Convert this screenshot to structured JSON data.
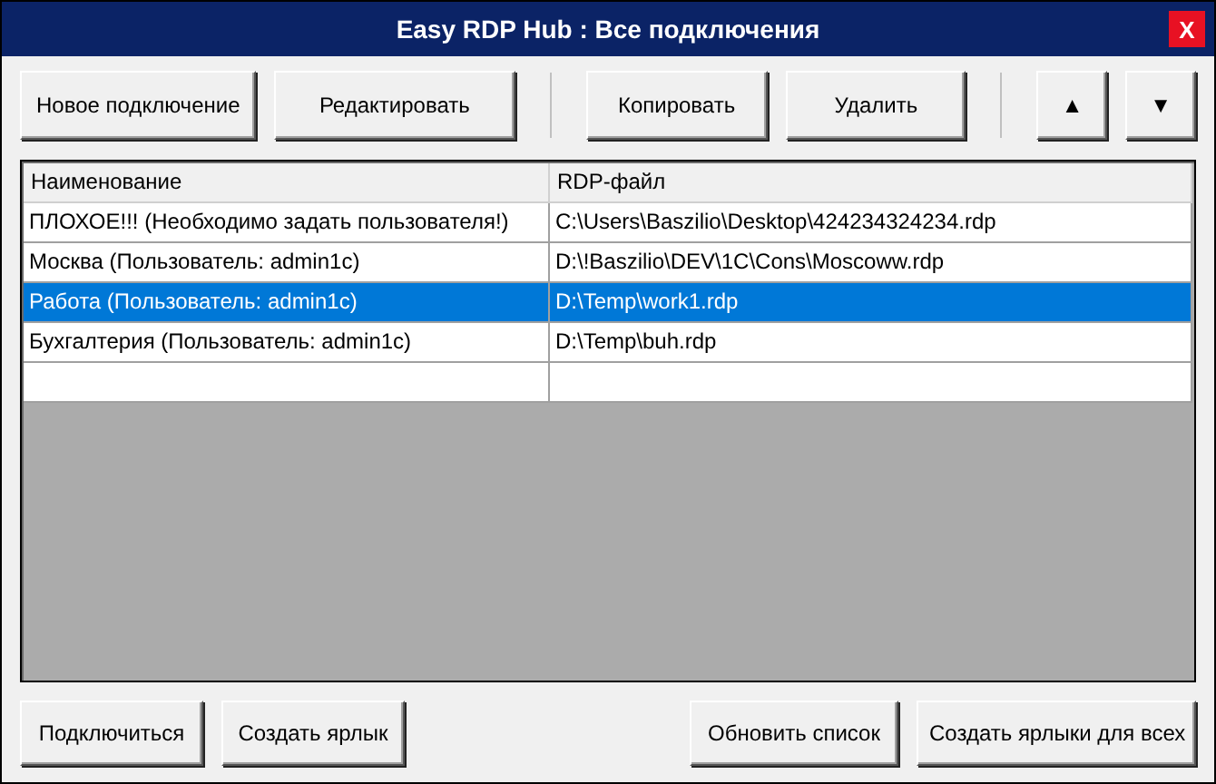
{
  "window": {
    "title": "Easy RDP Hub : Все подключения",
    "close": "X"
  },
  "toolbar": [
    {
      "kind": "button",
      "label": "Новое подключение"
    },
    {
      "kind": "button",
      "label": "Редактировать"
    },
    {
      "kind": "separator"
    },
    {
      "kind": "button",
      "label": "Копировать"
    },
    {
      "kind": "button",
      "label": "Удалить"
    },
    {
      "kind": "separator"
    },
    {
      "kind": "icon",
      "label": "▲"
    },
    {
      "kind": "icon",
      "label": "▼"
    }
  ],
  "table": {
    "columns": [
      "Наименование",
      "RDP-файл"
    ],
    "rows": [
      {
        "cells": [
          "ПЛОХОЕ!!! (Необходимо задать пользователя!)",
          "C:\\Users\\Baszilio\\Desktop\\424234324234.rdp"
        ],
        "selected": false
      },
      {
        "cells": [
          "Москва (Пользователь: admin1c)",
          "D:\\!Baszilio\\DEV\\1C\\Cons\\Moscoww.rdp"
        ],
        "selected": false
      },
      {
        "cells": [
          "Работа (Пользователь: admin1c)",
          "D:\\Temp\\work1.rdp"
        ],
        "selected": true
      },
      {
        "cells": [
          "Бухгалтерия (Пользователь: admin1c)",
          "D:\\Temp\\buh.rdp"
        ],
        "selected": false
      }
    ]
  },
  "bottom_left": [
    "Подключиться",
    "Создать ярлык"
  ],
  "bottom_right": [
    "Обновить список",
    "Создать ярлыки для всех"
  ]
}
